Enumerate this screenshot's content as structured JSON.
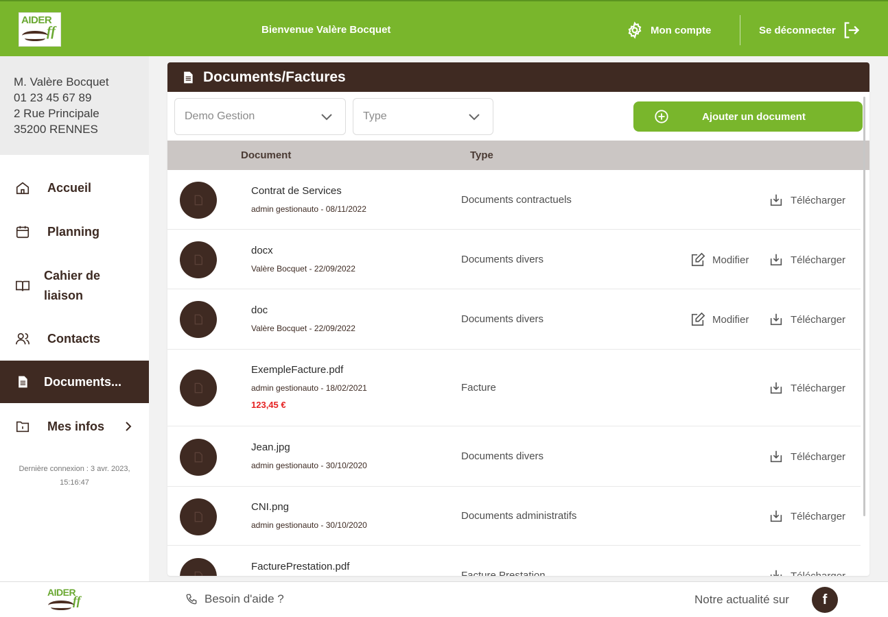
{
  "header": {
    "logo_text": "AIDER",
    "logo_mark": "ff",
    "welcome": "Bienvenue Valère Bocquet",
    "account_label": "Mon compte",
    "account_icon": "gear-icon",
    "logout_label": "Se déconnecter",
    "logout_icon": "logout-icon",
    "brand_color": "#79b62c",
    "dark_color": "#3f2a22"
  },
  "user": {
    "name": "M. Valère Bocquet",
    "phone": "01 23 45 67 89",
    "street": "2 Rue Principale",
    "city": "35200 RENNES"
  },
  "nav": {
    "items": [
      {
        "label": "Accueil",
        "icon": "home-icon"
      },
      {
        "label": "Planning",
        "icon": "calendar-icon"
      },
      {
        "label": "Cahier de",
        "label2": "liaison",
        "icon": "book-icon"
      },
      {
        "label": "Contacts",
        "icon": "people-icon"
      },
      {
        "label": "Documents...",
        "icon": "document-icon",
        "active": true
      },
      {
        "label": "Mes infos",
        "icon": "folder-icon"
      }
    ],
    "last_login_1": "Dernière connexion : 3 avr. 2023,",
    "last_login_2": "15:16:47"
  },
  "panel": {
    "title": "Documents/Factures",
    "filter_owner": "Demo Gestion",
    "filter_type": "Type",
    "add_label": "Ajouter un document",
    "col_document": "Document",
    "col_type": "Type",
    "edit_label": "Modifier",
    "download_label": "Télécharger"
  },
  "documents": [
    {
      "name": "Contrat de Services",
      "meta": "admin gestionauto - 08/11/2022",
      "type": "Documents contractuels",
      "editable": false
    },
    {
      "name": "docx",
      "meta": "Valère Bocquet - 22/09/2022",
      "type": "Documents divers",
      "editable": true
    },
    {
      "name": "doc",
      "meta": "Valère Bocquet - 22/09/2022",
      "type": "Documents divers",
      "editable": true
    },
    {
      "name": "ExempleFacture.pdf",
      "meta": "admin gestionauto - 18/02/2021",
      "price": "123,45 €",
      "type": "Facture",
      "editable": false
    },
    {
      "name": "Jean.jpg",
      "meta": "admin gestionauto - 30/10/2020",
      "type": "Documents divers",
      "editable": false
    },
    {
      "name": "CNI.png",
      "meta": "admin gestionauto - 30/10/2020",
      "type": "Documents administratifs",
      "editable": false
    },
    {
      "name": "FacturePrestation.pdf",
      "meta": "",
      "type": "Facture Prestation",
      "editable": false
    }
  ],
  "footer": {
    "help_label": "Besoin d'aide ?",
    "news_label": "Notre actualité sur",
    "facebook_glyph": "f"
  }
}
